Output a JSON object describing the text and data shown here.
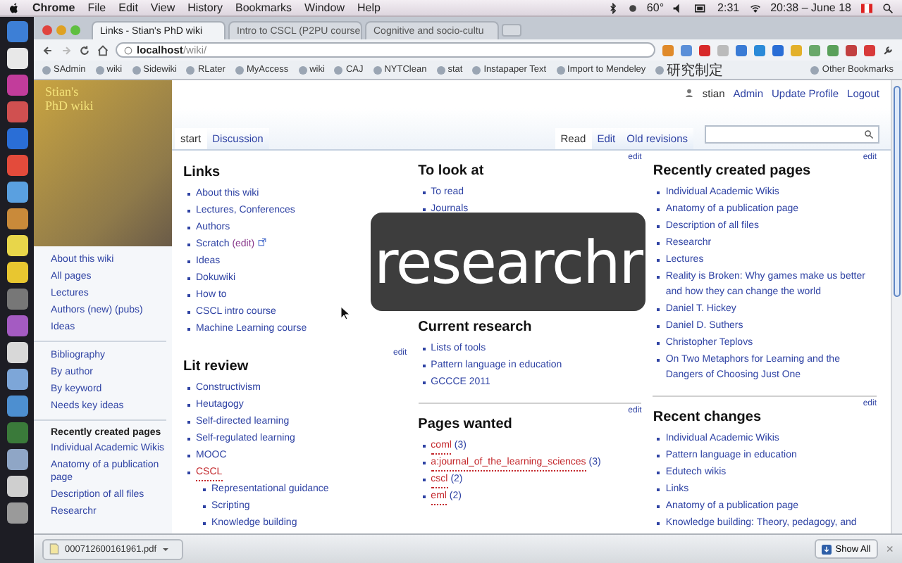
{
  "menubar": {
    "app": "Chrome",
    "menus": [
      "File",
      "Edit",
      "View",
      "History",
      "Bookmarks",
      "Window",
      "Help"
    ],
    "temperature": "60°",
    "battery": "2:31",
    "clock": "20:38 – June 18"
  },
  "browser": {
    "tabs": [
      {
        "title": "Links - Stian's PhD wiki",
        "selected": true
      },
      {
        "title": "Intro to CSCL (P2PU course",
        "selected": false
      },
      {
        "title": "Cognitive and socio-cultu",
        "selected": false
      }
    ],
    "address": {
      "host": "localhost",
      "path": "/wiki/"
    },
    "bookmarks": [
      "SAdmin",
      "wiki",
      "Sidewiki",
      "RLater",
      "MyAccess",
      "wiki",
      "CAJ",
      "NYTClean",
      "stat",
      "Instapaper Text",
      "Import to Mendeley",
      "研究制定"
    ],
    "other_bookmarks": "Other Bookmarks"
  },
  "wiki": {
    "logo": {
      "lines": [
        "Stian's",
        "PhD wiki"
      ]
    },
    "user_links": [
      "stian",
      "Admin",
      "Update Profile",
      "Logout"
    ],
    "sidebar": [
      {
        "items": [
          "About this wiki",
          "All pages",
          "Lectures",
          "Authors (new) (pubs)",
          "Ideas"
        ]
      },
      {
        "items": [
          "Bibliography",
          "By author",
          "By keyword",
          "Needs key ideas"
        ]
      },
      {
        "title": "Recently created pages",
        "items": [
          "Individual Academic Wikis",
          "Anatomy of a publication page",
          "Description of all files",
          "Researchr"
        ]
      }
    ],
    "page_tabs": {
      "left": [
        {
          "label": "start",
          "selected": true
        },
        {
          "label": "Discussion",
          "selected": false
        }
      ],
      "right": [
        {
          "label": "Read",
          "selected": true
        },
        {
          "label": "Edit",
          "selected": false
        },
        {
          "label": "Old revisions",
          "selected": false
        }
      ]
    },
    "columns": [
      [
        {
          "title": "Links",
          "items": [
            {
              "kind": "link",
              "text": "About this wiki"
            },
            {
              "kind": "link",
              "text": "Lectures, Conferences"
            },
            {
              "kind": "link",
              "text": "Authors"
            },
            {
              "kind": "link",
              "text": "Scratch",
              "suffix": "(edit)",
              "external": true
            },
            {
              "kind": "link",
              "text": "Ideas"
            },
            {
              "kind": "link",
              "text": "Dokuwiki"
            },
            {
              "kind": "link",
              "text": "How to"
            },
            {
              "kind": "link",
              "text": "CSCL intro course"
            },
            {
              "kind": "link",
              "text": "Machine Learning course"
            }
          ]
        },
        {
          "title": "Lit review",
          "edit": "edit",
          "items": [
            {
              "kind": "link",
              "text": "Constructivism"
            },
            {
              "kind": "link",
              "text": "Heutagogy"
            },
            {
              "kind": "link",
              "text": "Self-directed learning"
            },
            {
              "kind": "link",
              "text": "Self-regulated learning"
            },
            {
              "kind": "link",
              "text": "MOOC"
            },
            {
              "kind": "missing",
              "text": "CSCL",
              "children": [
                {
                  "kind": "link",
                  "text": "Representational guidance"
                },
                {
                  "kind": "link",
                  "text": "Scripting"
                },
                {
                  "kind": "link",
                  "text": "Knowledge building"
                }
              ]
            }
          ]
        }
      ],
      [
        {
          "title": "To look at",
          "edit": "edit",
          "items": [
            {
              "kind": "link",
              "text": "To read"
            },
            {
              "kind": "link",
              "text": "Journals"
            }
          ]
        },
        {
          "title": "Current research",
          "items": [
            {
              "kind": "link",
              "text": "Lists of tools"
            },
            {
              "kind": "link",
              "text": "Pattern language in education"
            },
            {
              "kind": "link",
              "text": "GCCCE 2011"
            }
          ]
        },
        {
          "title": "Pages wanted",
          "edit": "edit",
          "rule": true,
          "items": [
            {
              "kind": "missing",
              "text": "coml",
              "count": "(3)"
            },
            {
              "kind": "missing",
              "text": "a:journal_of_the_learning_sciences",
              "count": "(3)"
            },
            {
              "kind": "missing",
              "text": "cscl",
              "count": "(2)"
            },
            {
              "kind": "missing",
              "text": "eml",
              "count": "(2)"
            }
          ]
        }
      ],
      [
        {
          "title": "Recently created pages",
          "edit": "edit",
          "items": [
            {
              "kind": "link",
              "text": "Individual Academic Wikis"
            },
            {
              "kind": "link",
              "text": "Anatomy of a publication page"
            },
            {
              "kind": "link",
              "text": "Description of all files"
            },
            {
              "kind": "link",
              "text": "Researchr"
            },
            {
              "kind": "link",
              "text": "Lectures"
            },
            {
              "kind": "link",
              "text": "Reality is Broken: Why games make us better and how they can change the world"
            },
            {
              "kind": "link",
              "text": "Daniel T. Hickey"
            },
            {
              "kind": "link",
              "text": "Daniel D. Suthers"
            },
            {
              "kind": "link",
              "text": "Christopher Teplovs"
            },
            {
              "kind": "link",
              "text": "On Two Metaphors for Learning and the Dangers of Choosing Just One"
            }
          ]
        },
        {
          "title": "Recent changes",
          "edit": "edit",
          "rule": true,
          "items": [
            {
              "kind": "link",
              "text": "Individual Academic Wikis"
            },
            {
              "kind": "link",
              "text": "Pattern language in education"
            },
            {
              "kind": "link",
              "text": "Edutech wikis"
            },
            {
              "kind": "link",
              "text": "Links"
            },
            {
              "kind": "link",
              "text": "Anatomy of a publication page"
            },
            {
              "kind": "link",
              "text": "Knowledge building: Theory, pedagogy, and"
            }
          ]
        }
      ]
    ]
  },
  "overlay": {
    "text": "researchr"
  },
  "downloads": {
    "file": "000712600161961.pdf",
    "button": "Show All",
    "close": "×"
  }
}
